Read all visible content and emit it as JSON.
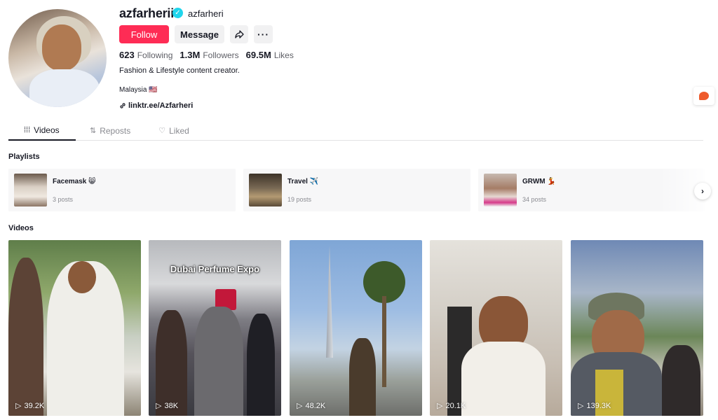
{
  "profile": {
    "username": "azfarherii",
    "verified_mark": "✓",
    "nickname": "azfarheri",
    "follow_label": "Follow",
    "message_label": "Message",
    "more_label": "···",
    "stats": {
      "following_count": "623",
      "following_label": "Following",
      "followers_count": "1.3M",
      "followers_label": "Followers",
      "likes_count": "69.5M",
      "likes_label": "Likes"
    },
    "bio": "Fashion & Lifestyle content creator.",
    "country": "Malaysia 🇺🇸",
    "link": "linktr.ee/Azfarheri"
  },
  "tabs": [
    {
      "label": "Videos",
      "icon": "grid-icon",
      "glyph": "⁞⁞⁞"
    },
    {
      "label": "Reposts",
      "icon": "repost-icon",
      "glyph": "⇅"
    },
    {
      "label": "Liked",
      "icon": "liked-icon",
      "glyph": "♡"
    }
  ],
  "playlists": {
    "title": "Playlists",
    "items": [
      {
        "name": "Facemask 😸",
        "count": "3 posts"
      },
      {
        "name": "Travel ✈️",
        "count": "19 posts"
      },
      {
        "name": "GRWM 💃",
        "count": "34 posts"
      }
    ]
  },
  "videos": {
    "title": "Videos",
    "items": [
      {
        "views": "39.2K",
        "caption": ""
      },
      {
        "views": "38K",
        "caption": "Dubai Perfume Expo"
      },
      {
        "views": "48.2K",
        "caption": ""
      },
      {
        "views": "20.1K",
        "caption": ""
      },
      {
        "views": "139.3K",
        "caption": ""
      }
    ]
  },
  "colors": {
    "accent": "#fe2c55",
    "verified": "#20d5ec",
    "text_primary": "#161823",
    "text_secondary": "#8a8b91"
  }
}
